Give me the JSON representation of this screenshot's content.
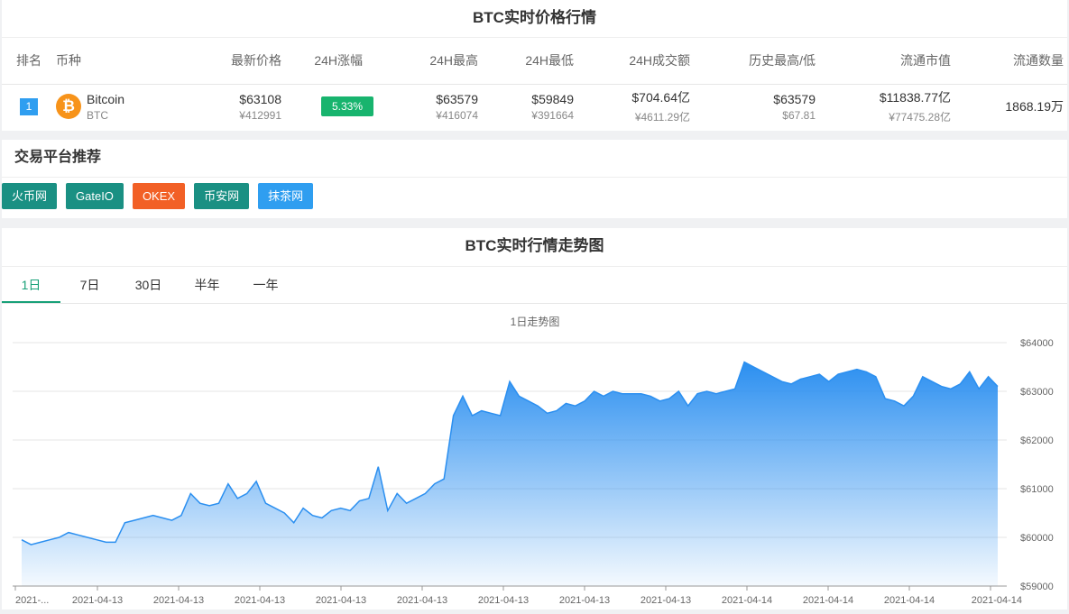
{
  "price_panel": {
    "title": "BTC实时价格行情",
    "headers": [
      "排名",
      "币种",
      "最新价格",
      "24H涨幅",
      "24H最高",
      "24H最低",
      "24H成交额",
      "历史最高/低",
      "流通市值",
      "流通数量"
    ],
    "row": {
      "rank": "1",
      "logo_icon": "bitcoin-icon",
      "logo_glyph": "₿",
      "name": "Bitcoin",
      "symbol": "BTC",
      "price_usd": "$63108",
      "price_cny": "¥412991",
      "change": "5.33%",
      "high_usd": "$63579",
      "high_cny": "¥416074",
      "low_usd": "$59849",
      "low_cny": "¥391664",
      "volume_usd": "$704.64亿",
      "volume_cny": "¥4611.29亿",
      "ath": "$63579",
      "atl": "$67.81",
      "mcap_usd": "$11838.77亿",
      "mcap_cny": "¥77475.28亿",
      "supply": "1868.19万"
    },
    "colors": {
      "change_up": "#18b46e",
      "rank_bg": "#2f9ef0",
      "btc_orange": "#f7931a"
    }
  },
  "exchanges": {
    "title": "交易平台推荐",
    "items": [
      {
        "label": "火币网",
        "color": "#1a9083"
      },
      {
        "label": "GateIO",
        "color": "#1a9083"
      },
      {
        "label": "OKEX",
        "color": "#f26026"
      },
      {
        "label": "币安网",
        "color": "#1a9083"
      },
      {
        "label": "抹茶网",
        "color": "#2f9ef0"
      }
    ]
  },
  "trend": {
    "title": "BTC实时行情走势图",
    "tabs": [
      "1日",
      "7日",
      "30日",
      "半年",
      "一年"
    ],
    "active_tab": "1日"
  },
  "chart_data": {
    "type": "area",
    "title": "1日走势图",
    "ylim": [
      59000,
      64000
    ],
    "yticks": [
      "$64000",
      "$63000",
      "$62000",
      "$61000",
      "$60000",
      "$59000"
    ],
    "xtick_labels": [
      "2021-...",
      "2021-04-13",
      "2021-04-13",
      "2021-04-13",
      "2021-04-13",
      "2021-04-13",
      "2021-04-13",
      "2021-04-13",
      "2021-04-13",
      "2021-04-14",
      "2021-04-14",
      "2021-04-14",
      "2021-04-14"
    ],
    "grid": true,
    "color": "#2b8ff0",
    "series": [
      {
        "values": [
          59950,
          59850,
          59900,
          59950,
          60000,
          60100,
          60050,
          60000,
          59950,
          59900,
          59900,
          60300,
          60350,
          60400,
          60450,
          60400,
          60350,
          60450,
          60900,
          60700,
          60650,
          60700,
          61100,
          60800,
          60900,
          61150,
          60700,
          60600,
          60500,
          60300,
          60600,
          60450,
          60400,
          60550,
          60600,
          60550,
          60750,
          60800,
          61450,
          60550,
          60900,
          60700,
          60800,
          60900,
          61100,
          61200,
          62500,
          62900,
          62500,
          62600,
          62550,
          62500,
          63200,
          62900,
          62800,
          62700,
          62550,
          62600,
          62750,
          62700,
          62800,
          63000,
          62900,
          63000,
          62950,
          62950,
          62950,
          62900,
          62800,
          62850,
          63000,
          62700,
          62950,
          63000,
          62950,
          63000,
          63050,
          63600,
          63500,
          63400,
          63300,
          63200,
          63150,
          63250,
          63300,
          63350,
          63200,
          63350,
          63400,
          63450,
          63400,
          63300,
          62850,
          62800,
          62700,
          62900,
          63300,
          63200,
          63100,
          63050,
          63150,
          63400,
          63050,
          63300,
          63100
        ]
      }
    ]
  }
}
